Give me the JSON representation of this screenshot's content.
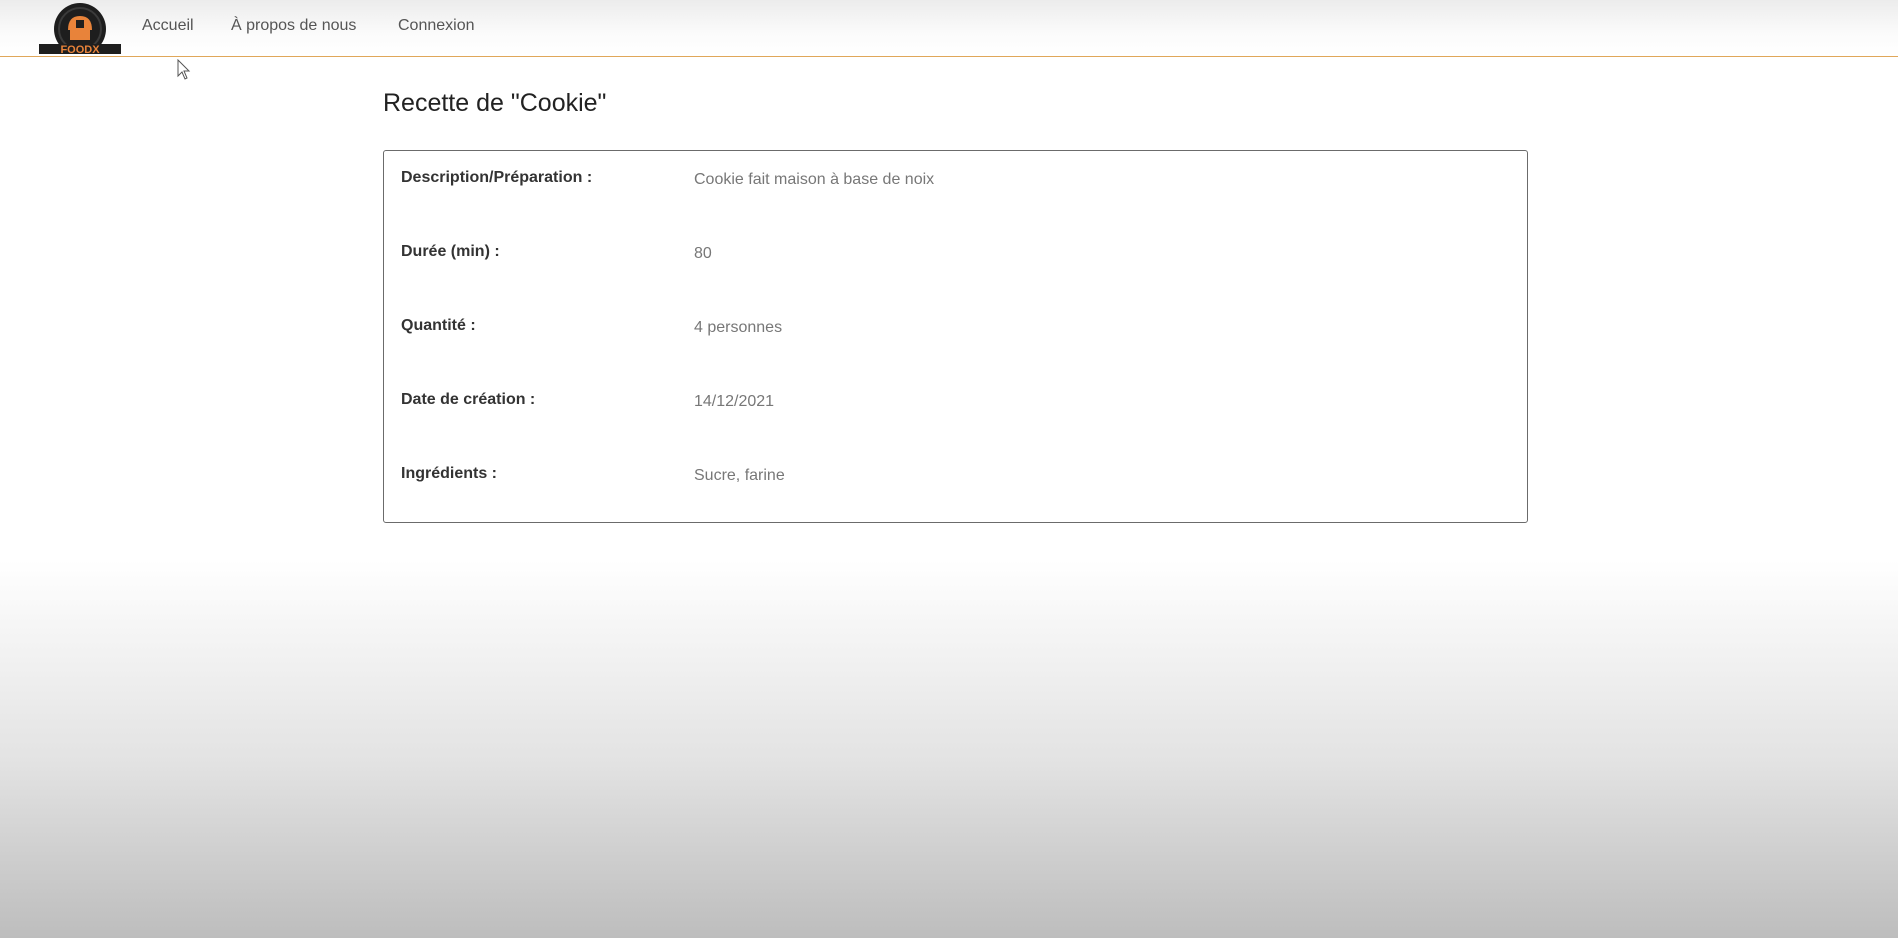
{
  "nav": {
    "logo_text": "FOODX",
    "links": [
      {
        "label": "Accueil"
      },
      {
        "label": "À propos de nous"
      },
      {
        "label": "Connexion"
      }
    ]
  },
  "page": {
    "title": "Recette de \"Cookie\""
  },
  "recipe": {
    "rows": [
      {
        "label": "Description/Préparation :",
        "value": "Cookie fait maison à base de noix"
      },
      {
        "label": "Durée (min) :",
        "value": "80"
      },
      {
        "label": "Quantité :",
        "value": "4 personnes"
      },
      {
        "label": "Date de création :",
        "value": "14/12/2021"
      },
      {
        "label": "Ingrédients :",
        "value": "Sucre, farine"
      }
    ]
  },
  "colors": {
    "accent": "#e0a75a",
    "logo_orange": "#e8833a",
    "logo_dark": "#1e1e1e"
  }
}
